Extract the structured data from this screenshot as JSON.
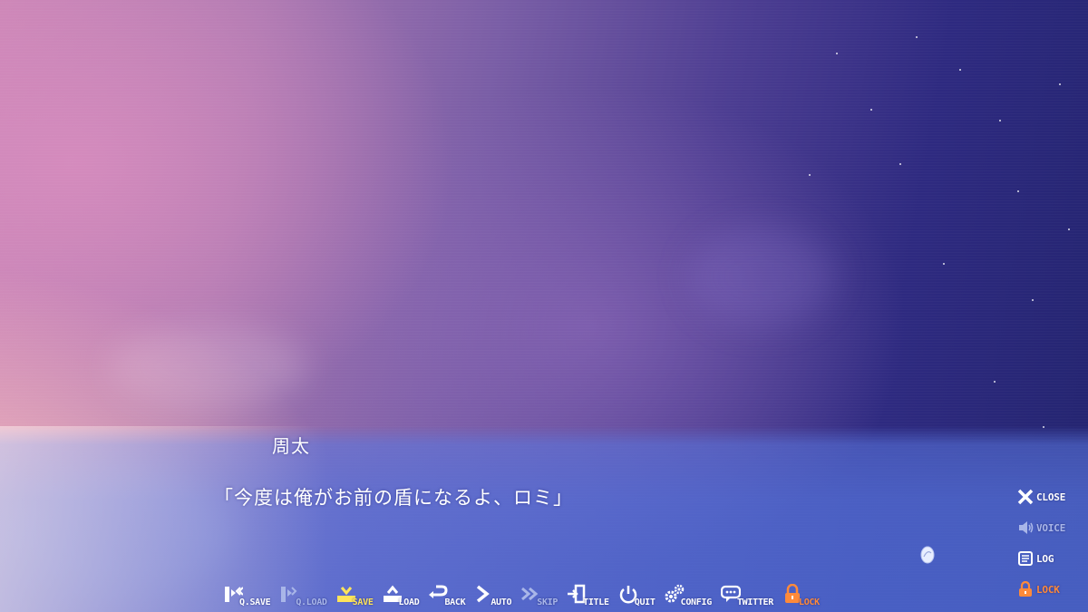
{
  "dialogue": {
    "speaker": "周太",
    "text": "「今度は俺がお前の盾になるよ、ロミ」"
  },
  "toolbar": [
    {
      "id": "qsave",
      "label": "Q.SAVE",
      "icon": "quick-save-icon",
      "color": "#ffffff"
    },
    {
      "id": "qload",
      "label": "Q.LOAD",
      "icon": "quick-load-icon",
      "color": "#a9b6e8"
    },
    {
      "id": "save",
      "label": "SAVE",
      "icon": "save-icon",
      "color": "#ffe45a"
    },
    {
      "id": "load",
      "label": "LOAD",
      "icon": "load-icon",
      "color": "#ffffff"
    },
    {
      "id": "back",
      "label": "BACK",
      "icon": "back-arrow-icon",
      "color": "#ffffff"
    },
    {
      "id": "auto",
      "label": "AUTO",
      "icon": "auto-play-icon",
      "color": "#ffffff"
    },
    {
      "id": "skip",
      "label": "SKIP",
      "icon": "skip-icon",
      "color": "#a9b6e8"
    },
    {
      "id": "title",
      "label": "TITLE",
      "icon": "exit-door-icon",
      "color": "#ffffff"
    },
    {
      "id": "quit",
      "label": "QUIT",
      "icon": "power-icon",
      "color": "#ffffff"
    },
    {
      "id": "config",
      "label": "CONFIG",
      "icon": "gears-icon",
      "color": "#ffffff"
    },
    {
      "id": "twitter",
      "label": "TWITTER",
      "icon": "speech-bubble-icon",
      "color": "#ffffff"
    },
    {
      "id": "lock",
      "label": "LOCK",
      "icon": "padlock-icon",
      "color": "#ff8a3a"
    }
  ],
  "side_menu": [
    {
      "id": "close",
      "label": "CLOSE",
      "icon": "close-icon",
      "color": "#ffffff"
    },
    {
      "id": "voice",
      "label": "VOICE",
      "icon": "speaker-icon",
      "color": "#a9b6e8"
    },
    {
      "id": "log",
      "label": "LOG",
      "icon": "log-icon",
      "color": "#ffffff"
    },
    {
      "id": "lock",
      "label": "LOCK",
      "icon": "padlock-icon",
      "color": "#ff8a3a"
    }
  ]
}
